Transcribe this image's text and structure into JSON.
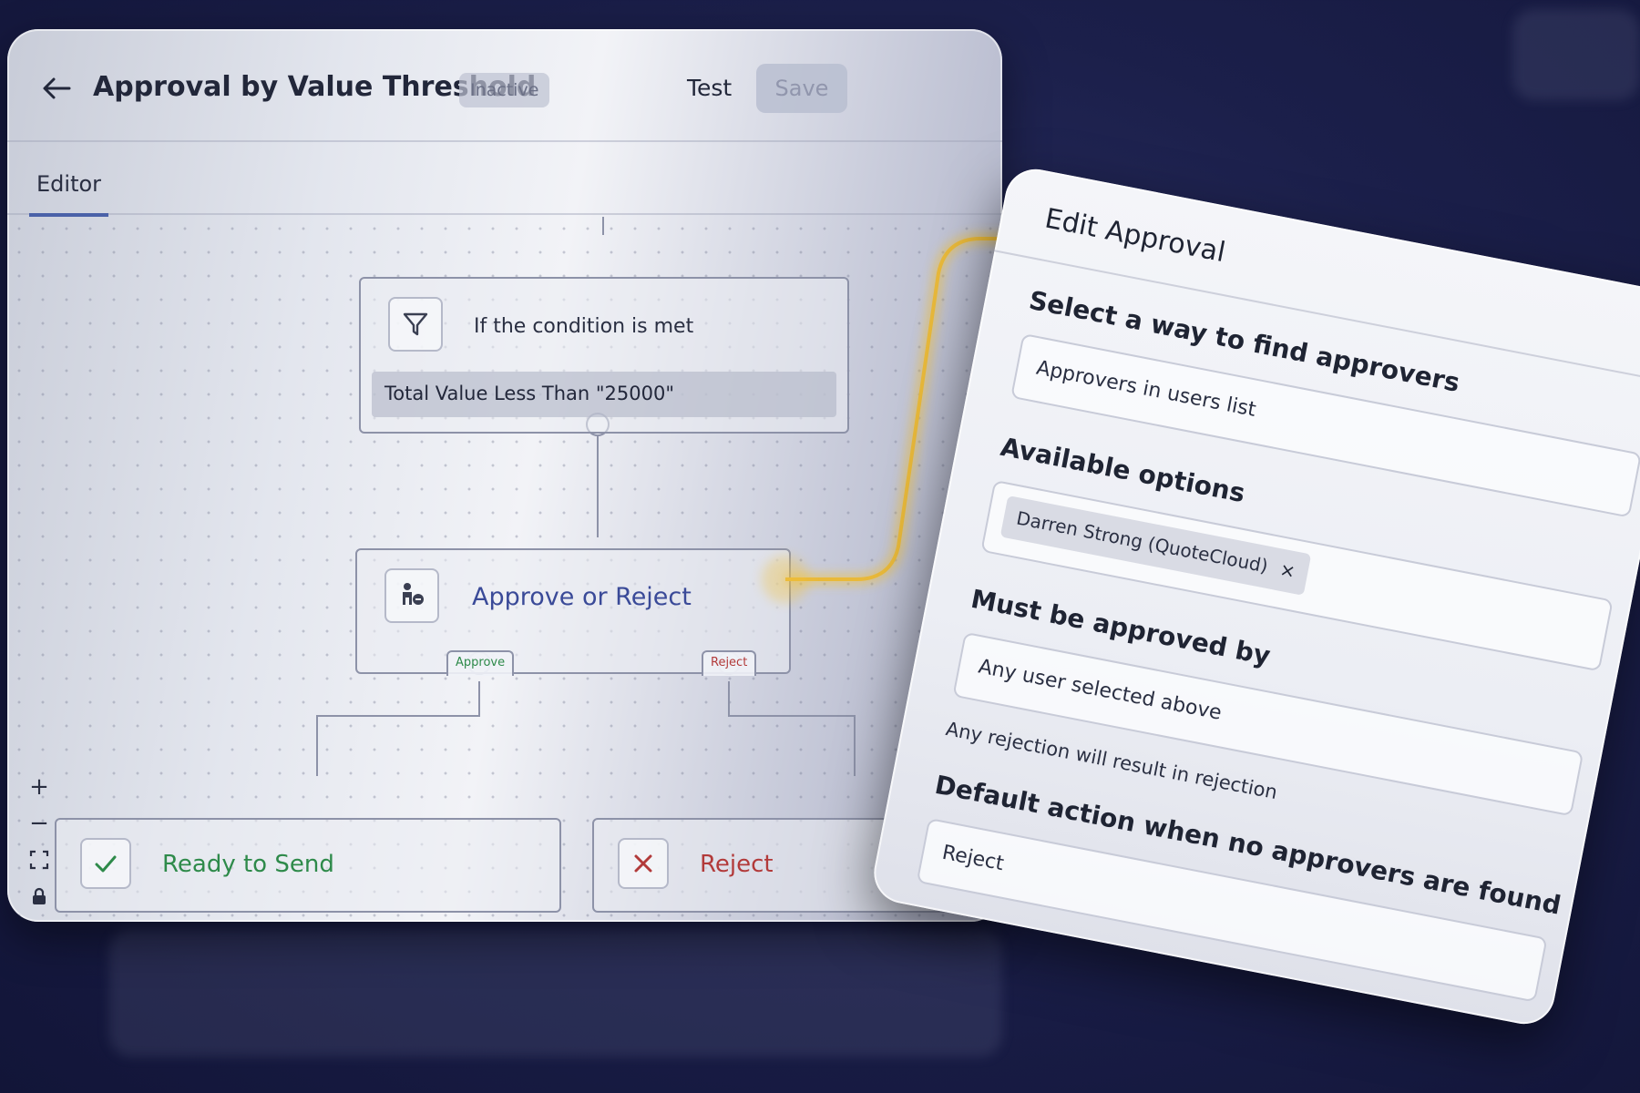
{
  "header": {
    "title": "Approval by Value Threshold",
    "status": "Inactive",
    "test_label": "Test",
    "save_label": "Save"
  },
  "tabs": [
    {
      "label": "Editor",
      "active": true
    }
  ],
  "flow": {
    "condition_node": {
      "label": "If the condition is met",
      "value": "Total Value Less Than \"25000\""
    },
    "approval_node": {
      "label": "Approve or Reject",
      "approve_tag": "Approve",
      "reject_tag": "Reject"
    },
    "ready_node": {
      "label": "Ready to Send"
    },
    "reject_node": {
      "label": "Reject"
    }
  },
  "zoom_controls": {
    "zoom_in": "+",
    "zoom_out": "−"
  },
  "edit_panel": {
    "title": "Edit Approval",
    "find_approvers_label": "Select a way to find approvers",
    "find_approvers_value": "Approvers in users list",
    "options_label": "Available options",
    "selected_option": "Darren Strong (QuoteCloud)",
    "chip_remove": "×",
    "approved_by_label": "Must be approved by",
    "approved_by_value": "Any user selected above",
    "rejection_note": "Any rejection will result in rejection",
    "default_action_label": "Default action when no approvers are found",
    "default_action_value": "Reject"
  },
  "colors": {
    "accent": "#4a61a8",
    "approve": "#2e8a4a",
    "reject": "#b23a3a",
    "glow": "#f2c23a"
  }
}
